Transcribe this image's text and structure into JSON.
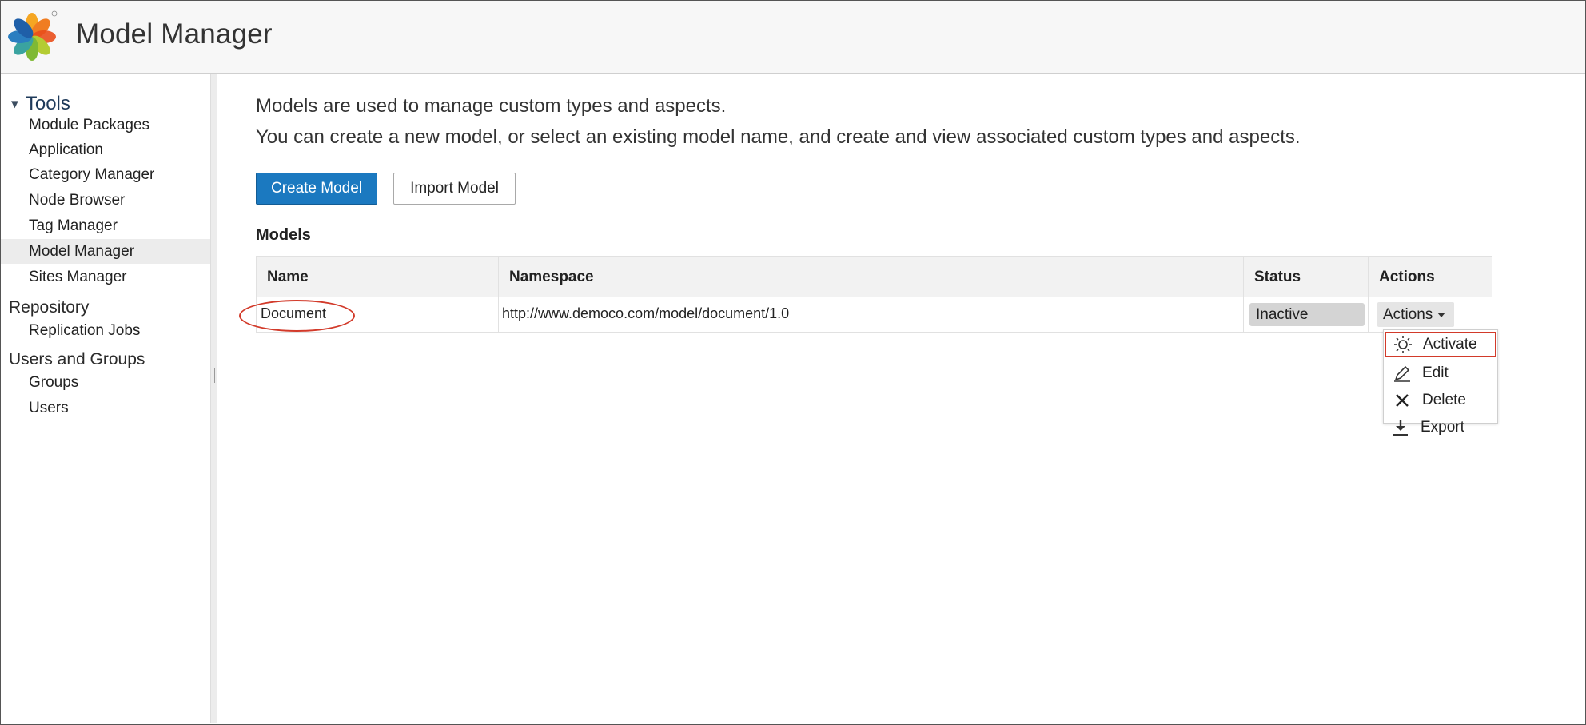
{
  "header": {
    "title": "Model Manager"
  },
  "sidebar": {
    "sections": [
      {
        "label": "Tools",
        "items": [
          "Module Packages",
          "Application",
          "Category Manager",
          "Node Browser",
          "Tag Manager",
          "Model Manager",
          "Sites Manager"
        ]
      },
      {
        "label": "Repository",
        "items": [
          "Replication Jobs"
        ]
      },
      {
        "label": "Users and Groups",
        "items": [
          "Groups",
          "Users"
        ]
      }
    ],
    "active_item": "Model Manager"
  },
  "main": {
    "intro_line1": "Models are used to manage custom types and aspects.",
    "intro_line2": "You can create a new model, or select an existing model name, and create and view associated custom types and aspects.",
    "create_label": "Create Model",
    "import_label": "Import Model",
    "section_title": "Models",
    "table": {
      "headers": [
        "Name",
        "Namespace",
        "Status",
        "Actions"
      ],
      "rows": [
        {
          "name": "Document",
          "namespace": "http://www.democo.com/model/document/1.0",
          "status": "Inactive",
          "actions": "Actions"
        }
      ]
    },
    "actions_menu": [
      "Activate",
      "Edit",
      "Delete",
      "Export"
    ]
  },
  "colors": {
    "primary_button": "#1b79c0",
    "annotation": "#d23a2a"
  }
}
